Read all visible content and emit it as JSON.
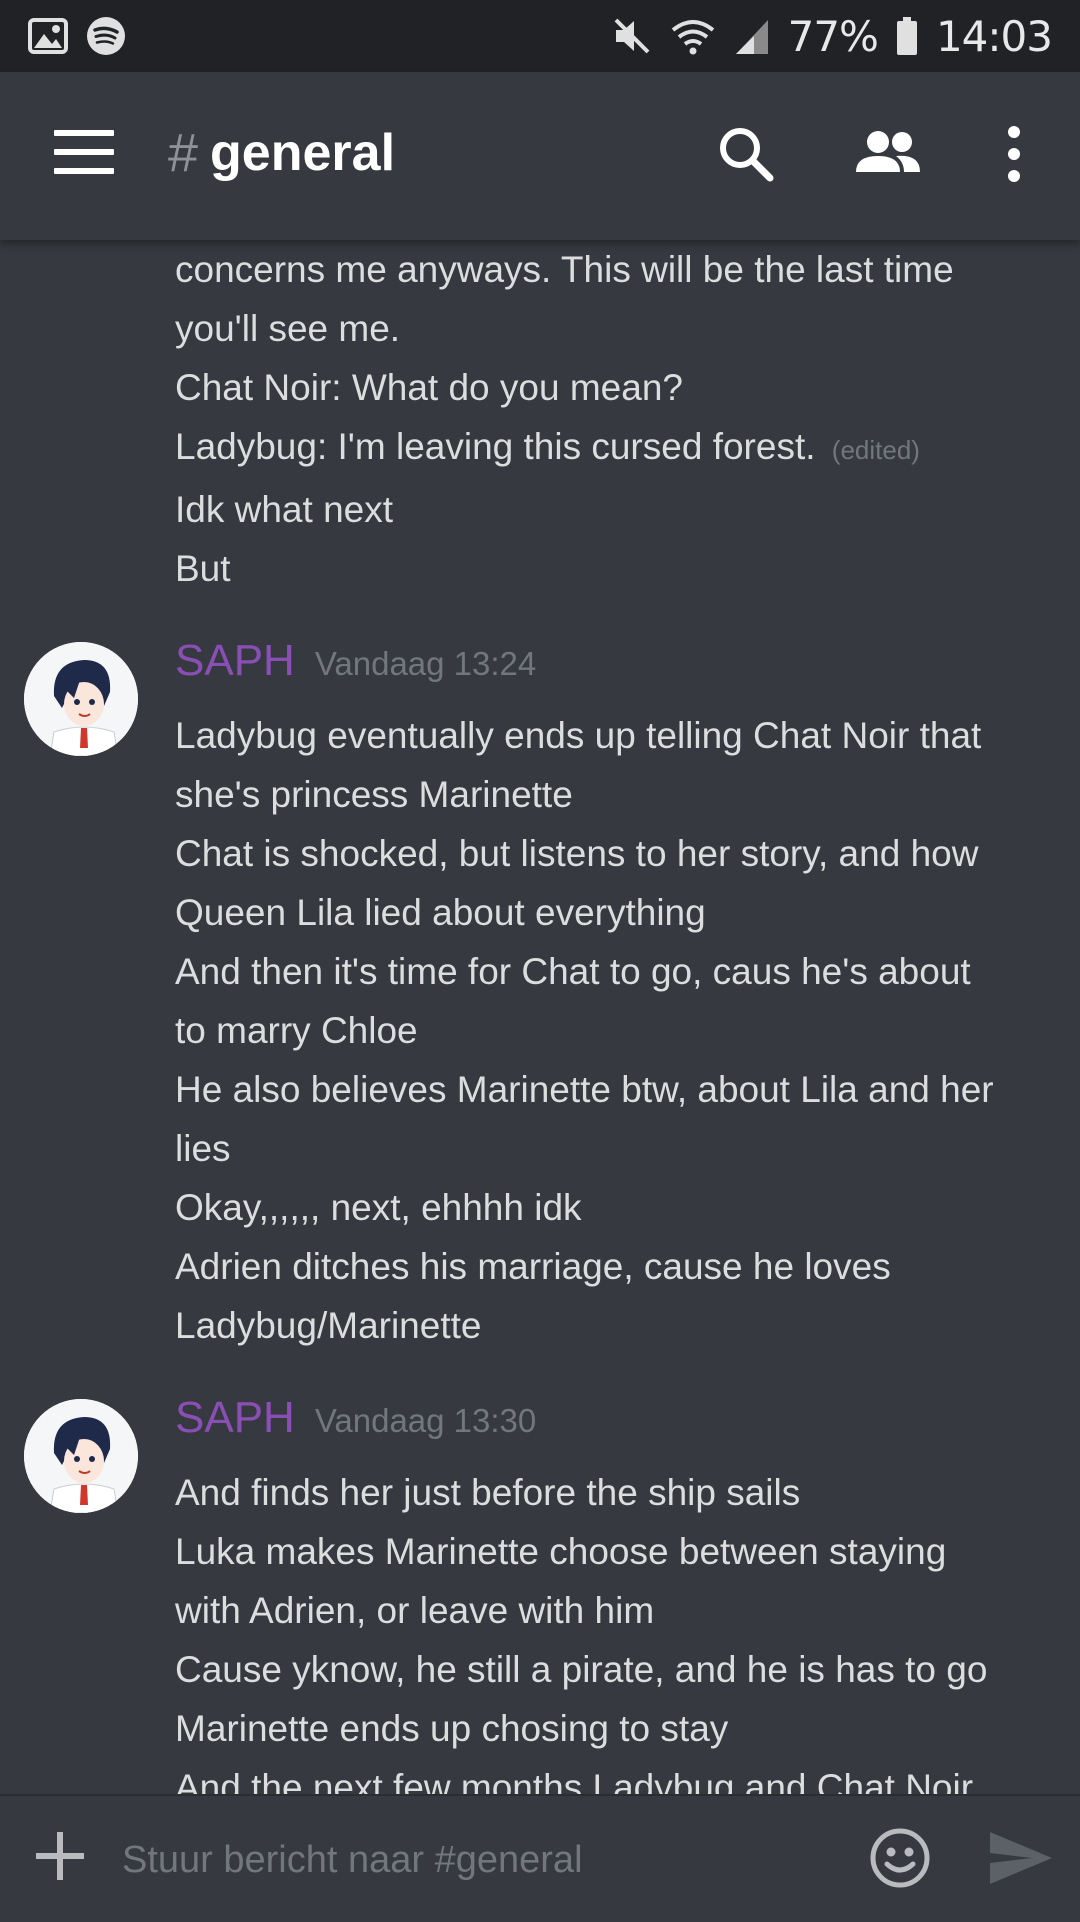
{
  "statusbar": {
    "battery": "77%",
    "time": "14:03"
  },
  "channel": {
    "hash": "#",
    "name": "general"
  },
  "messages": {
    "continued": [
      {
        "text": "concerns me anyways. This will be the last time"
      },
      {
        "text": "you'll see me."
      },
      {
        "text": "Chat Noir: What do you mean?"
      },
      {
        "text": "Ladybug: I'm leaving this cursed forest.",
        "edited": "(edited)"
      },
      {
        "text": "Idk what next"
      },
      {
        "text": "But"
      }
    ],
    "group1": {
      "author": "SAPH",
      "timestamp": "Vandaag 13:24",
      "lines": [
        "Ladybug eventually ends up telling Chat Noir that",
        "she's princess Marinette",
        "Chat is shocked, but listens to her story, and how",
        "Queen Lila lied about everything",
        "And then it's time for Chat to go, caus he's about",
        "to marry Chloe",
        "He also believes Marinette btw, about Lila and her",
        "lies",
        "Okay,,,,,, next, ehhhh idk",
        "Adrien ditches his marriage, cause he loves",
        "Ladybug/Marinette"
      ]
    },
    "group2": {
      "author": "SAPH",
      "timestamp": "Vandaag 13:30",
      "lines": [
        "And finds her just before the ship sails",
        "Luka makes Marinette choose between staying",
        "with Adrien, or leave with him",
        "Cause yknow, he still a pirate, and he is has to go",
        "Marinette ends up chosing to stay",
        "And the next few months Ladybug and Chat Noir"
      ]
    }
  },
  "composer": {
    "placeholder": "Stuur bericht naar #general"
  },
  "colors": {
    "background": "#36393f",
    "statusbar": "#202225",
    "author": "#8a4fb4",
    "muted": "#72767d"
  },
  "icons": [
    "image-icon",
    "spotify-icon",
    "mute-icon",
    "wifi-icon",
    "signal-icon",
    "battery-icon",
    "menu-icon",
    "search-icon",
    "members-icon",
    "more-icon",
    "plus-icon",
    "emoji-icon",
    "send-icon"
  ]
}
